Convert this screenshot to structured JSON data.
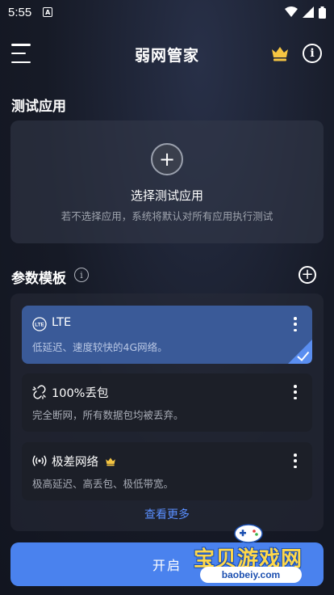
{
  "status_bar": {
    "time": "5:55",
    "notification_badge": "A"
  },
  "app_bar": {
    "title": "弱网管家"
  },
  "test_app_section": {
    "title": "测试应用",
    "select_label": "选择测试应用",
    "hint": "若不选择应用，系统将默认对所有应用执行测试"
  },
  "params_section": {
    "title": "参数模板",
    "templates": [
      {
        "name": "LTE",
        "description": "低延迟、速度较快的4G网络。",
        "icon": "lte-icon",
        "selected": true,
        "premium": false
      },
      {
        "name": "100%丢包",
        "description": "完全断网，所有数据包均被丢弃。",
        "icon": "broken-link-icon",
        "selected": false,
        "premium": false
      },
      {
        "name": "极差网络",
        "description": "极高延迟、高丢包、极低带宽。",
        "icon": "signal-broadcast-icon",
        "selected": false,
        "premium": true
      }
    ],
    "view_more": "查看更多"
  },
  "start_button": {
    "label": "开启"
  },
  "watermark": {
    "name": "宝贝游戏网",
    "url": "baobeiy.com"
  },
  "colors": {
    "accent": "#4a82ee",
    "selected_card": "#3a5a98",
    "crown": "#f5c542",
    "link": "#5a8fff"
  }
}
